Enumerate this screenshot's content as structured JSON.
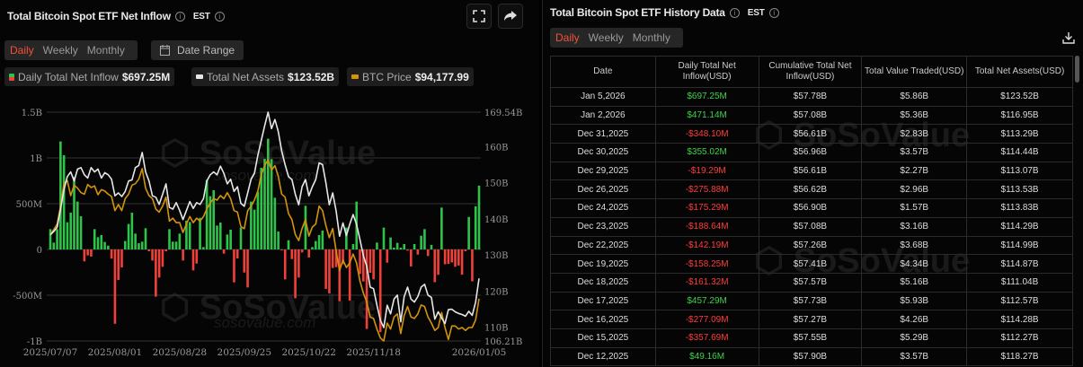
{
  "left": {
    "title": "Total Bitcoin Spot ETF Net Inflow",
    "timezone": "EST",
    "tabs": [
      {
        "label": "Daily",
        "active": true
      },
      {
        "label": "Weekly"
      },
      {
        "label": "Monthly"
      }
    ],
    "date_range_label": "Date Range",
    "icons": {
      "fullscreen": "fullscreen-icon",
      "share": "share-icon",
      "calendar": "calendar-icon"
    },
    "legend": [
      {
        "label": "Daily Total Net Inflow",
        "value": "$697.25M"
      },
      {
        "label": "Total Net Assets",
        "value": "$123.52B"
      },
      {
        "label": "BTC Price",
        "value": "$94,177.99"
      }
    ],
    "watermark": [
      "SoSoValue",
      "sosovalue.com"
    ]
  },
  "colors": {
    "inflow_pos": "#2fc34a",
    "inflow_neg": "#f0403a",
    "net_assets": "#e6e6e6",
    "btc_price": "#d4930c",
    "active_tab": "#f0513a"
  },
  "chart_data": {
    "type": "bar+line",
    "left_axis": {
      "ticks": [
        "1.5B",
        "1B",
        "500M",
        "0",
        "-500M",
        "-1B"
      ],
      "tick_values_musd": [
        1500,
        1000,
        500,
        0,
        -500,
        -1000
      ],
      "range_musd": [
        -1000,
        1500
      ]
    },
    "right_axis": {
      "ticks": [
        "169.54B",
        "160B",
        "150B",
        "140B",
        "130B",
        "120B",
        "110B",
        "106.21B"
      ],
      "tick_values_busd": [
        169.54,
        160,
        150,
        140,
        130,
        120,
        110,
        106.21
      ],
      "range_busd": [
        106.21,
        169.54
      ]
    },
    "x_ticks": [
      "2025/07/07",
      "2025/08/01",
      "2025/08/28",
      "2025/09/25",
      "2025/10/22",
      "2025/11/18",
      "2026/01/05"
    ],
    "grid": "horizontal",
    "dates": [
      "2025/07/07",
      "2025/07/08",
      "2025/07/09",
      "2025/07/10",
      "2025/07/11",
      "2025/07/14",
      "2025/07/15",
      "2025/07/16",
      "2025/07/17",
      "2025/07/18",
      "2025/07/21",
      "2025/07/22",
      "2025/07/23",
      "2025/07/24",
      "2025/07/25",
      "2025/07/28",
      "2025/07/29",
      "2025/07/30",
      "2025/07/31",
      "2025/08/01",
      "2025/08/04",
      "2025/08/05",
      "2025/08/06",
      "2025/08/07",
      "2025/08/08",
      "2025/08/11",
      "2025/08/12",
      "2025/08/13",
      "2025/08/14",
      "2025/08/15",
      "2025/08/18",
      "2025/08/19",
      "2025/08/20",
      "2025/08/21",
      "2025/08/22",
      "2025/08/25",
      "2025/08/26",
      "2025/08/27",
      "2025/08/28",
      "2025/08/29",
      "2025/09/02",
      "2025/09/03",
      "2025/09/04",
      "2025/09/05",
      "2025/09/08",
      "2025/09/09",
      "2025/09/10",
      "2025/09/11",
      "2025/09/12",
      "2025/09/15",
      "2025/09/16",
      "2025/09/17",
      "2025/09/18",
      "2025/09/19",
      "2025/09/22",
      "2025/09/23",
      "2025/09/24",
      "2025/09/25",
      "2025/09/26",
      "2025/09/29",
      "2025/09/30",
      "2025/10/01",
      "2025/10/02",
      "2025/10/03",
      "2025/10/06",
      "2025/10/07",
      "2025/10/08",
      "2025/10/09",
      "2025/10/10",
      "2025/10/13",
      "2025/10/14",
      "2025/10/15",
      "2025/10/16",
      "2025/10/17",
      "2025/10/20",
      "2025/10/21",
      "2025/10/22",
      "2025/10/23",
      "2025/10/24",
      "2025/10/27",
      "2025/10/28",
      "2025/10/29",
      "2025/10/30",
      "2025/10/31",
      "2025/11/03",
      "2025/11/04",
      "2025/11/05",
      "2025/11/06",
      "2025/11/07",
      "2025/11/10",
      "2025/11/11",
      "2025/11/12",
      "2025/11/13",
      "2025/11/14",
      "2025/11/17",
      "2025/11/18",
      "2025/11/19",
      "2025/11/20",
      "2025/11/21",
      "2025/11/24",
      "2025/11/25",
      "2025/11/26",
      "2025/11/28",
      "2025/12/01",
      "2025/12/02",
      "2025/12/03",
      "2025/12/04",
      "2025/12/05",
      "2025/12/08",
      "2025/12/09",
      "2025/12/10",
      "2025/12/11",
      "2025/12/12",
      "2025/12/15",
      "2025/12/16",
      "2025/12/17",
      "2025/12/18",
      "2025/12/19",
      "2025/12/22",
      "2025/12/23",
      "2025/12/24",
      "2025/12/26",
      "2025/12/29",
      "2025/12/30",
      "2025/12/31",
      "2026/01/02",
      "2026/01/05"
    ],
    "series": [
      {
        "name": "Daily Total Net Inflow",
        "kind": "bar",
        "unit": "M USD",
        "values": [
          222,
          75,
          222,
          1180,
          1030,
          297,
          402,
          794,
          523,
          363,
          -130,
          -65,
          -78,
          222,
          134,
          157,
          82,
          42,
          -100,
          -812,
          -333,
          -196,
          92,
          278,
          402,
          173,
          69,
          85,
          232,
          -20,
          -121,
          -516,
          -307,
          -189,
          -20,
          222,
          85,
          85,
          173,
          -121,
          314,
          300,
          -229,
          -154,
          346,
          26,
          761,
          582,
          647,
          261,
          294,
          -46,
          163,
          216,
          -360,
          -98,
          239,
          -252,
          -415,
          523,
          435,
          631,
          892,
          990,
          1210,
          987,
          565,
          196,
          -10,
          -327,
          101,
          -105,
          -533,
          -307,
          -33,
          477,
          -88,
          26,
          92,
          157,
          206,
          -431,
          -480,
          -203,
          -193,
          -565,
          -160,
          239,
          -558,
          59,
          523,
          -268,
          -350,
          -869,
          -255,
          -327,
          75,
          -903,
          239,
          -144,
          131,
          20,
          72,
          20,
          59,
          -13,
          -186,
          59,
          -56,
          150,
          222,
          -72,
          49.16,
          -357.69,
          -277.09,
          457.29,
          -161.32,
          -158.25,
          -142.19,
          -188.64,
          -175.29,
          -275.88,
          -19.29,
          355.02,
          -348.1,
          471.14,
          697.25
        ]
      },
      {
        "name": "Total Net Assets",
        "kind": "line",
        "unit": "B USD",
        "axis": "right",
        "values": [
          135.6,
          136.5,
          137.7,
          142.7,
          148,
          151.7,
          153,
          150.5,
          153.8,
          154.2,
          152.2,
          151.3,
          154.2,
          153,
          153.8,
          151.3,
          152.8,
          152.2,
          151,
          146.4,
          147.2,
          146.2,
          147.6,
          150.5,
          150.8,
          154.2,
          154.8,
          158.4,
          153,
          150.5,
          146.4,
          146,
          144,
          146.8,
          149.7,
          143.2,
          142.7,
          144.5,
          142.3,
          139.8,
          142.3,
          144.8,
          142.9,
          144.5,
          144,
          145.6,
          150.5,
          152.2,
          153,
          152.2,
          154.6,
          152.6,
          149.7,
          151,
          147.6,
          148.9,
          144.3,
          143.5,
          147.2,
          151,
          152.6,
          157.6,
          161.7,
          165.8,
          169.54,
          165,
          167.5,
          164.2,
          158.8,
          155,
          151.7,
          150.9,
          146.8,
          143.9,
          148.9,
          150.9,
          146.4,
          148.9,
          150.9,
          155.5,
          155,
          150,
          143.9,
          147.2,
          142.2,
          135.2,
          138.9,
          135.4,
          138.5,
          141.2,
          138.5,
          134.3,
          129.8,
          126.9,
          121.1,
          120.7,
          116.1,
          112,
          109.9,
          116.1,
          113.7,
          117.8,
          118.9,
          111.5,
          118.5,
          121.1,
          117.8,
          117,
          118.5,
          121.1,
          121.9,
          118.9,
          118.27,
          112.27,
          114.28,
          112.57,
          111.04,
          114.87,
          114.99,
          114.29,
          113.83,
          113.53,
          113.07,
          114.44,
          113.29,
          116.95,
          123.52
        ]
      },
      {
        "name": "BTC Price",
        "kind": "line",
        "unit": "USD",
        "values": [
          108860,
          110000,
          111270,
          115385,
          120530,
          121210,
          117780,
          120190,
          119500,
          118470,
          118120,
          120330,
          119640,
          120000,
          118000,
          119170,
          118830,
          118120,
          117580,
          114350,
          115730,
          114350,
          117090,
          118120,
          120190,
          120530,
          121560,
          123970,
          119500,
          117780,
          117090,
          114700,
          114000,
          115390,
          117440,
          111950,
          112630,
          111600,
          111600,
          109350,
          111270,
          113000,
          111600,
          112630,
          111950,
          113000,
          114700,
          116080,
          117090,
          116770,
          117780,
          117090,
          118470,
          117090,
          114350,
          114000,
          110710,
          110230,
          114350,
          115390,
          116770,
          118830,
          122590,
          124650,
          126030,
          123620,
          124650,
          122240,
          118130,
          117440,
          113670,
          112300,
          108860,
          107490,
          110240,
          112300,
          108520,
          110580,
          111270,
          115390,
          114360,
          110920,
          108180,
          110240,
          105090,
          100630,
          103030,
          101320,
          102350,
          104410,
          102350,
          98230,
          95480,
          93420,
          89990,
          89650,
          87240,
          85180,
          84500,
          88620,
          87240,
          89990,
          90680,
          86210,
          90330,
          92390,
          89990,
          89650,
          90680,
          92740,
          92390,
          89990,
          88620,
          86900,
          87590,
          91020,
          87590,
          84850,
          87930,
          87930,
          87240,
          87590,
          86900,
          87590,
          87590,
          89300,
          94177.99
        ]
      }
    ]
  },
  "right": {
    "title": "Total Bitcoin Spot ETF History Data",
    "timezone": "EST",
    "tabs": [
      {
        "label": "Daily",
        "active": true
      },
      {
        "label": "Weekly"
      },
      {
        "label": "Monthly"
      }
    ],
    "download_icon": "download-icon",
    "columns": [
      "Date",
      "Daily Total Net Inflow(USD)",
      "Cumulative Total Net Inflow(USD)",
      "Total Value Traded(USD)",
      "Total Net Assets(USD)"
    ],
    "rows": [
      [
        "Jan 5,2026",
        "$697.25M",
        "$57.78B",
        "$5.86B",
        "$123.52B"
      ],
      [
        "Jan 2,2026",
        "$471.14M",
        "$57.08B",
        "$5.36B",
        "$116.95B"
      ],
      [
        "Dec 31,2025",
        "-$348.10M",
        "$56.61B",
        "$2.83B",
        "$113.29B"
      ],
      [
        "Dec 30,2025",
        "$355.02M",
        "$56.96B",
        "$3.57B",
        "$114.44B"
      ],
      [
        "Dec 29,2025",
        "-$19.29M",
        "$56.61B",
        "$2.27B",
        "$113.07B"
      ],
      [
        "Dec 26,2025",
        "-$275.88M",
        "$56.62B",
        "$2.96B",
        "$113.53B"
      ],
      [
        "Dec 24,2025",
        "-$175.29M",
        "$56.90B",
        "$1.57B",
        "$113.83B"
      ],
      [
        "Dec 23,2025",
        "-$188.64M",
        "$57.08B",
        "$3.16B",
        "$114.29B"
      ],
      [
        "Dec 22,2025",
        "-$142.19M",
        "$57.26B",
        "$3.68B",
        "$114.99B"
      ],
      [
        "Dec 19,2025",
        "-$158.25M",
        "$57.41B",
        "$4.34B",
        "$114.87B"
      ],
      [
        "Dec 18,2025",
        "-$161.32M",
        "$57.57B",
        "$5.16B",
        "$111.04B"
      ],
      [
        "Dec 17,2025",
        "$457.29M",
        "$57.73B",
        "$5.93B",
        "$112.57B"
      ],
      [
        "Dec 16,2025",
        "-$277.09M",
        "$57.27B",
        "$4.26B",
        "$114.28B"
      ],
      [
        "Dec 15,2025",
        "-$357.69M",
        "$57.55B",
        "$5.29B",
        "$112.27B"
      ],
      [
        "Dec 12,2025",
        "$49.16M",
        "$57.90B",
        "$3.57B",
        "$118.27B"
      ]
    ]
  }
}
